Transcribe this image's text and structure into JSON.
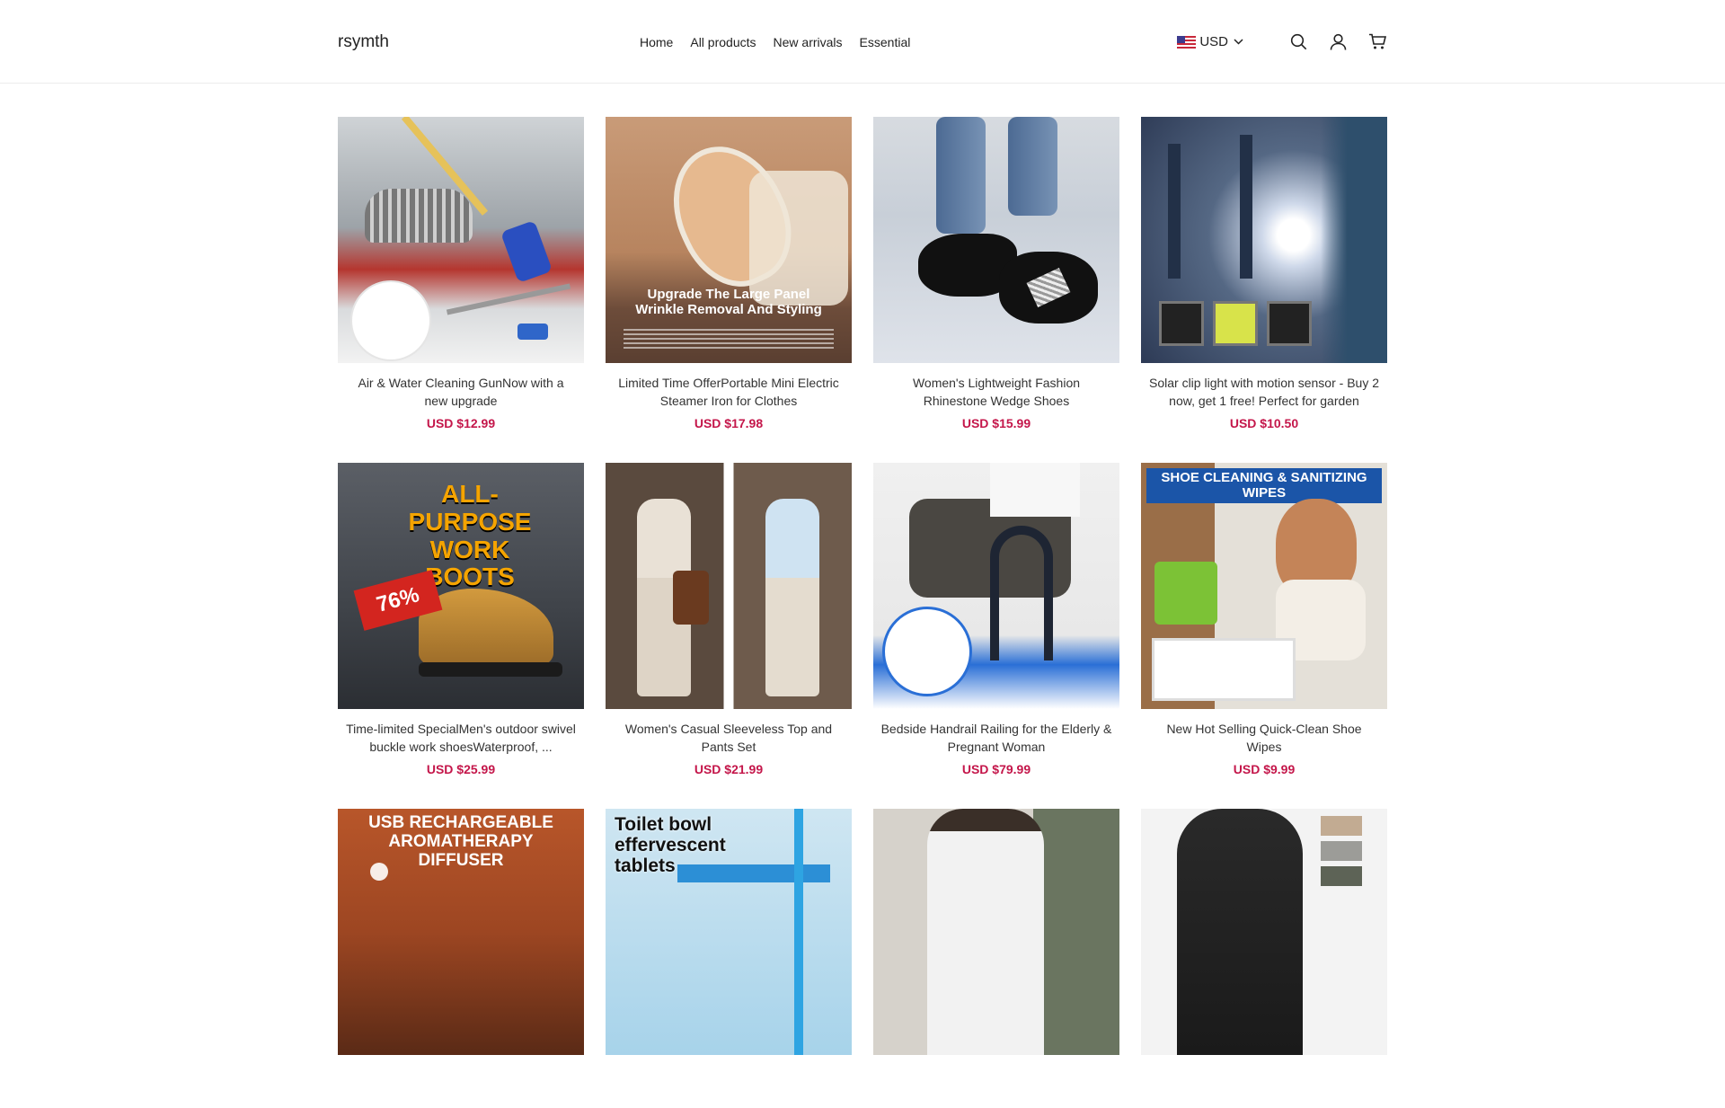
{
  "store": {
    "name": "rsymth"
  },
  "nav": {
    "items": [
      {
        "label": "Home"
      },
      {
        "label": "All products"
      },
      {
        "label": "New arrivals"
      },
      {
        "label": "Essential"
      }
    ]
  },
  "currency": {
    "code": "USD",
    "flag_icon": "us-flag-icon"
  },
  "icons": {
    "search": "search-icon",
    "account": "user-icon",
    "cart": "cart-icon"
  },
  "colors": {
    "price": "#c4164a",
    "border": "#ececec"
  },
  "products": [
    {
      "title": "Air & Water Cleaning GunNow with a new upgrade",
      "price": "USD $12.99",
      "image_text": ""
    },
    {
      "title": "Limited Time OfferPortable Mini Electric Steamer Iron for Clothes",
      "price": "USD $17.98",
      "image_text": "Upgrade The Large Panel Wrinkle Removal And Styling"
    },
    {
      "title": "Women's Lightweight Fashion Rhinestone Wedge Shoes",
      "price": "USD $15.99",
      "image_text": ""
    },
    {
      "title": " Solar clip light with motion sensor - Buy 2 now, get 1 free! Perfect for garden",
      "price": "USD $10.50",
      "image_text": ""
    },
    {
      "title": "Time-limited SpecialMen's outdoor swivel buckle work shoesWaterproof, ...",
      "price": "USD $25.99",
      "image_text": "ALL-PURPOSE WORK BOOTS",
      "badge": "76%"
    },
    {
      "title": "Women's Casual Sleeveless Top and Pants Set",
      "price": "USD $21.99",
      "image_text": ""
    },
    {
      "title": "Bedside Handrail Railing for the Elderly & Pregnant Woman",
      "price": "USD $79.99",
      "image_text": ""
    },
    {
      "title": "New Hot Selling Quick-Clean Shoe Wipes",
      "price": "USD $9.99",
      "image_text": "SHOE CLEANING & SANITIZING WIPES"
    },
    {
      "title": "",
      "price": "",
      "image_text": "USB RECHARGEABLE AROMATHERAPY DIFFUSER"
    },
    {
      "title": "",
      "price": "",
      "image_text": "Toilet bowl effervescent tablets"
    },
    {
      "title": "",
      "price": "",
      "image_text": ""
    },
    {
      "title": "",
      "price": "",
      "image_text": ""
    }
  ]
}
